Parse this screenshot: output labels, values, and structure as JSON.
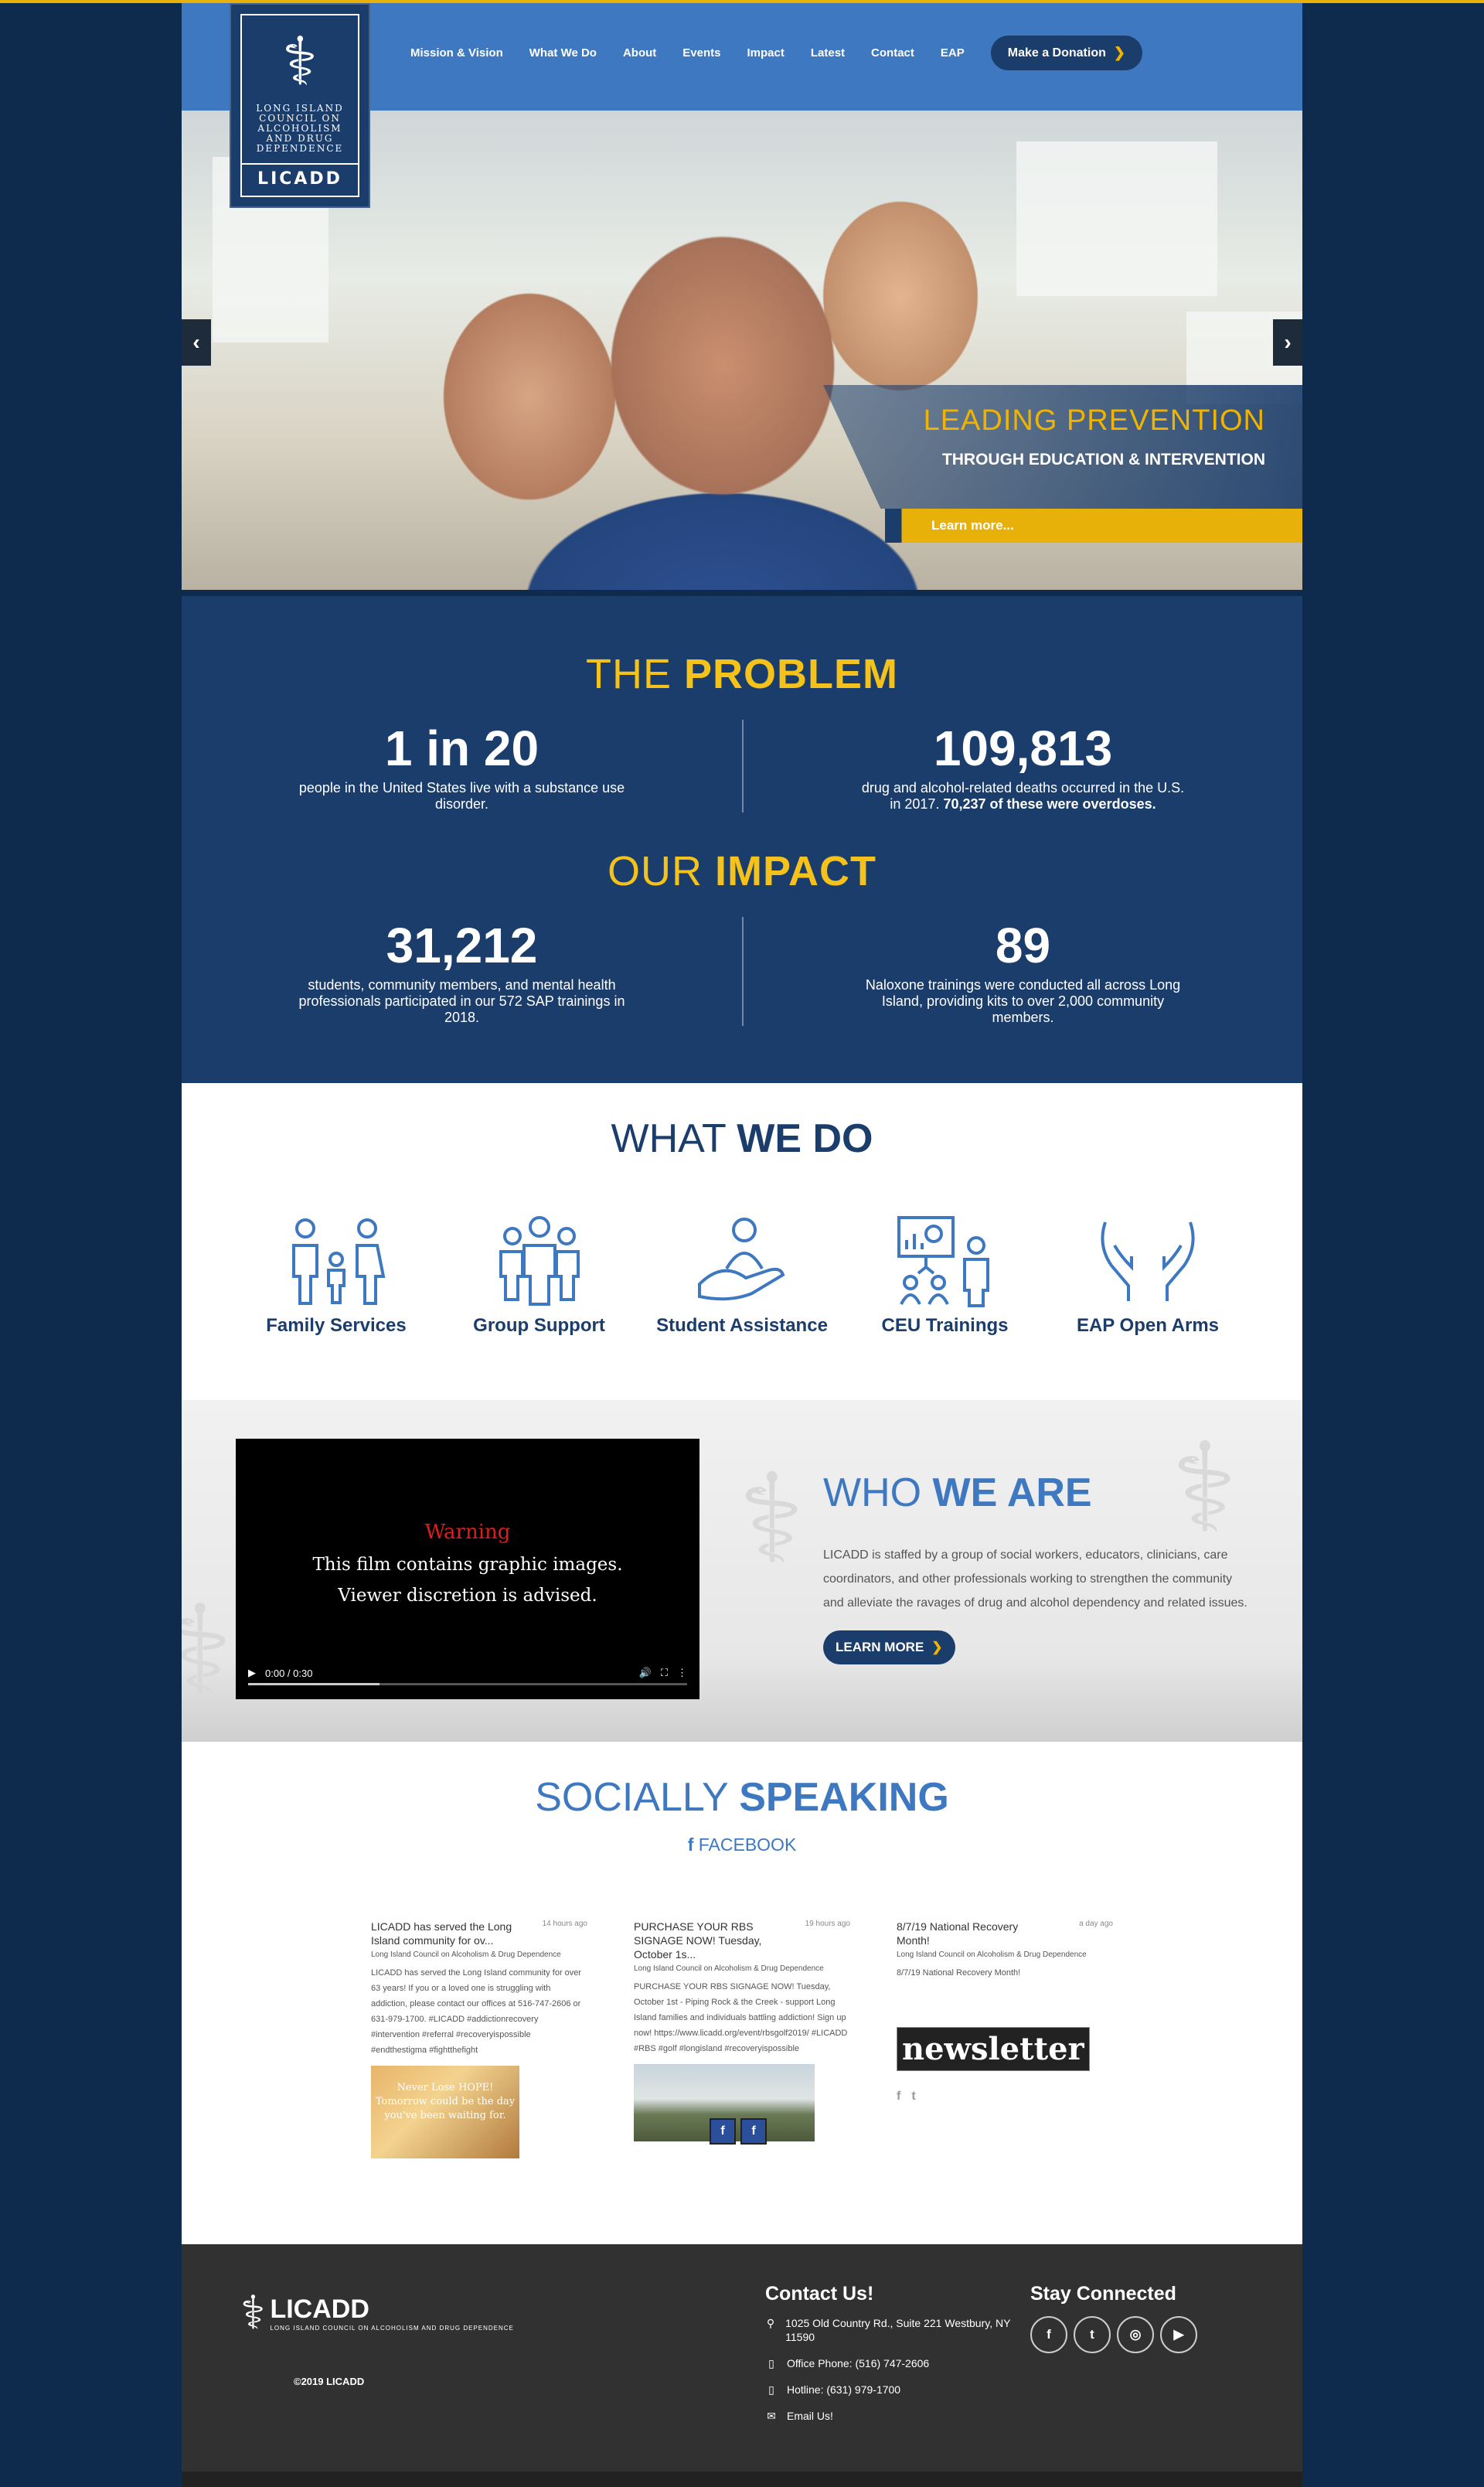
{
  "header": {
    "logo": {
      "glyph": "⚕",
      "subtitle": "LONG ISLAND COUNCIL ON ALCOHOLISM AND DRUG DEPENDENCE",
      "name": "LICADD"
    },
    "nav": [
      "Mission & Vision",
      "What We Do",
      "About",
      "Events",
      "Impact",
      "Latest",
      "Contact",
      "EAP"
    ],
    "donate_label": "Make a Donation"
  },
  "hero": {
    "prev_label": "‹",
    "next_label": "›",
    "caption_title": "LEADING PREVENTION",
    "caption_sub": "THROUGH EDUCATION & INTERVENTION",
    "learn_label": "Learn more..."
  },
  "problem": {
    "head_light": "THE ",
    "head_bold": "PROBLEM",
    "stats": [
      {
        "num": "1 in 20",
        "text": "people in the United States live with a substance use disorder."
      },
      {
        "num": "109,813",
        "text": "drug and alcohol-related deaths occurred in the U.S. in 2017.",
        "bold": " 70,237 of these were overdoses."
      }
    ]
  },
  "impact": {
    "head_light": "OUR ",
    "head_bold": "IMPACT",
    "stats": [
      {
        "num": "31,212",
        "text": "students, community members, and mental health professionals participated in our 572 SAP trainings in 2018."
      },
      {
        "num": "89",
        "text": "Naloxone trainings were conducted all across Long Island, providing kits to over 2,000 community members."
      }
    ]
  },
  "what_we_do": {
    "head_light": "WHAT ",
    "head_bold": "WE DO",
    "services": [
      "Family Services",
      "Group Support",
      "Student Assistance",
      "CEU Trainings",
      "EAP Open Arms"
    ]
  },
  "who_we_are": {
    "video": {
      "warning": "Warning",
      "line1": "This film contains graphic images.",
      "line2": "Viewer discretion is advised.",
      "time": "0:00 / 0:30"
    },
    "head_light": "WHO ",
    "head_bold": "WE ARE",
    "text": "LICADD is staffed by a group of social workers, educators, clinicians, care coordinators, and other professionals working to strengthen the community and alleviate the ravages of drug and alcohol dependency and related issues.",
    "button": "LEARN MORE"
  },
  "social": {
    "head_light": "SOCIALLY ",
    "head_bold": "SPEAKING",
    "facebook_label": "FACEBOOK",
    "posts": [
      {
        "title": "LICADD has served the Long Island community for ov...",
        "time": "14 hours ago",
        "author": "Long Island Council on Alcoholism & Drug Dependence",
        "body": "LICADD has served the Long Island community for over 63 years! If you or a loved one is struggling with addiction, please contact our offices at 516-747-2606 or 631-979-1700. #LICADD #addictionrecovery #intervention #referral #recoveryispossible #endthestigma #fightthefight",
        "image_text": "Never Lose HOPE! Tomorrow could be the day you've been waiting for."
      },
      {
        "title": "PURCHASE YOUR RBS SIGNAGE NOW! Tuesday, October 1s...",
        "time": "19 hours ago",
        "author": "Long Island Council on Alcoholism & Drug Dependence",
        "body": "PURCHASE YOUR RBS SIGNAGE NOW! Tuesday, October 1st - Piping Rock & the Creek - support Long Island families and individuals battling addiction! Sign up now! https://www.licadd.org/event/rbsgolf2019/ #LICADD #RBS #golf #longisland #recoveryispossible",
        "image_text": "f"
      },
      {
        "title": "8/7/19 National Recovery Month!",
        "time": "a day ago",
        "author": "Long Island Council on Alcoholism & Drug Dependence",
        "body": "8/7/19 National Recovery Month!",
        "image_text": "newsletter"
      }
    ],
    "share_icons": [
      "f",
      "t"
    ]
  },
  "footer": {
    "logo_name": "LICADD",
    "logo_sub": "LONG ISLAND COUNCIL ON ALCOHOLISM AND DRUG DEPENDENCE",
    "copyright": "©2019 LICADD",
    "contact_title": "Contact Us!",
    "address": "1025 Old Country Rd., Suite 221 Westbury, NY 11590",
    "phone": "Office Phone: (516) 747-2606",
    "hotline": "Hotline: (631) 979-1700",
    "email": "Email Us!",
    "stay_title": "Stay Connected",
    "socials": [
      "f",
      "t",
      "◎",
      "▶"
    ]
  },
  "colors": {
    "navy": "#1b3d6b",
    "blue": "#3d78c0",
    "gold": "#f4c21a",
    "bg": "#0e2a4c"
  }
}
